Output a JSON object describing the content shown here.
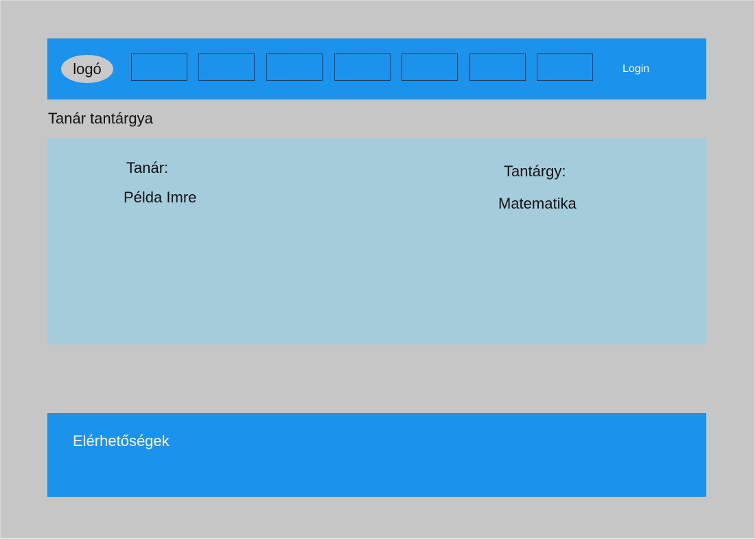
{
  "header": {
    "logo_text": "logó",
    "login_label": "Login"
  },
  "page": {
    "title": "Tanár tantárgya"
  },
  "content": {
    "teacher_label": "Tanár:",
    "teacher_value": "Példa Imre",
    "subject_label": "Tantárgy:",
    "subject_value": "Matematika"
  },
  "footer": {
    "contacts_label": "Elérhetőségek"
  },
  "colors": {
    "background": "#c6c6c6",
    "bar": "#1b93ec",
    "panel": "#a5ccdb"
  }
}
